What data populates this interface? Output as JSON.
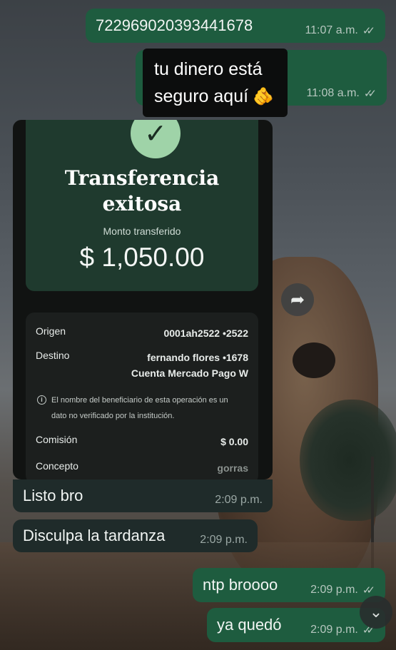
{
  "messages": {
    "m1": {
      "text": "722969020393441678",
      "time": "11:07 a.m.",
      "ticks": "✓✓"
    },
    "m2": {
      "time": "11:08 a.m.",
      "ticks": "✓✓"
    },
    "m3": {
      "text": "Listo bro",
      "time": "2:09 p.m."
    },
    "m4": {
      "text": "Disculpa la tardanza",
      "time": "2:09 p.m."
    },
    "m5": {
      "text": "ntp broooo",
      "time": "2:09 p.m.",
      "ticks": "✓✓"
    },
    "m6": {
      "text": "ya quedó",
      "time": "2:09 p.m.",
      "ticks": "✓✓"
    }
  },
  "sticker": {
    "line1": "tu dinero está",
    "line2": "seguro aquí",
    "emoji": "🫵"
  },
  "receipt": {
    "check_icon": "checkmark-icon",
    "check_glyph": "✓",
    "title_line1": "Transferencia",
    "title_line2": "exitosa",
    "subtitle": "Monto transferido",
    "amount": "$ 1,050.00",
    "origin_label": "Origen",
    "origin_value": "0001ah2522 •2522",
    "dest_label": "Destino",
    "dest_value_line1": "fernando flores •1678",
    "dest_value_line2": "Cuenta Mercado Pago W",
    "info_glyph": "i",
    "note_line1": "El nombre del beneficiario de esta operación es un",
    "note_line2": "dato no verificado por la institución.",
    "fee_label": "Comisión",
    "fee_value": "$ 0.00",
    "concept_label": "Concepto",
    "concept_value": "gorras"
  },
  "controls": {
    "forward_glyph": "➦",
    "scroll_down_glyph": "⌄"
  },
  "colors": {
    "outgoing_bubble": "#1e5c3f",
    "incoming_bubble": "#1f2b2a",
    "receipt_header": "#1f3a2e",
    "check_accent": "#9fd3a8"
  }
}
